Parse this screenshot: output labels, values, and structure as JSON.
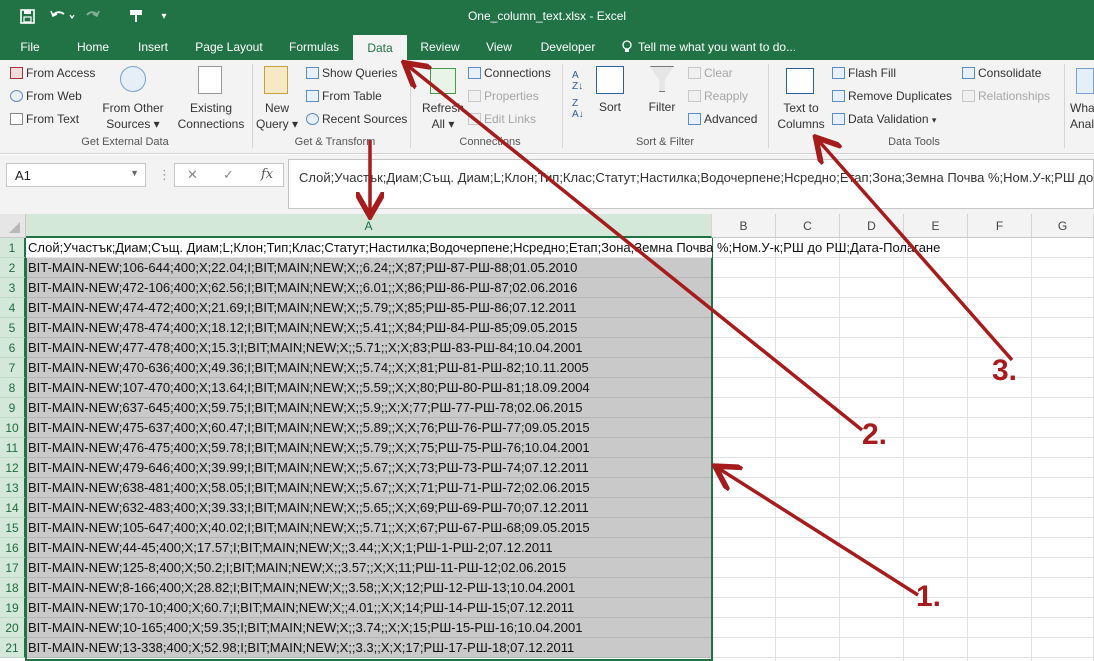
{
  "window": {
    "title": "One_column_text.xlsx - Excel"
  },
  "tabs": [
    {
      "label": "File",
      "active": false
    },
    {
      "label": "Home",
      "active": false
    },
    {
      "label": "Insert",
      "active": false
    },
    {
      "label": "Page Layout",
      "active": false
    },
    {
      "label": "Formulas",
      "active": false
    },
    {
      "label": "Data",
      "active": true
    },
    {
      "label": "Review",
      "active": false
    },
    {
      "label": "View",
      "active": false
    },
    {
      "label": "Developer",
      "active": false
    },
    {
      "label": "Tell me what you want to do...",
      "active": false
    }
  ],
  "ribbon": {
    "get_external": {
      "from_access": "From Access",
      "from_web": "From Web",
      "from_text": "From Text",
      "from_other_1": "From Other",
      "from_other_2": "Sources",
      "existing_1": "Existing",
      "existing_2": "Connections",
      "group": "Get External Data"
    },
    "transform": {
      "new_query_1": "New",
      "new_query_2": "Query",
      "show_queries": "Show Queries",
      "from_table": "From Table",
      "recent_sources": "Recent Sources",
      "group": "Get & Transform"
    },
    "connections": {
      "refresh_1": "Refresh",
      "refresh_2": "All",
      "connections": "Connections",
      "properties": "Properties",
      "edit_links": "Edit Links",
      "group": "Connections"
    },
    "sort_filter": {
      "sort": "Sort",
      "filter": "Filter",
      "clear": "Clear",
      "reapply": "Reapply",
      "advanced": "Advanced",
      "group": "Sort & Filter"
    },
    "data_tools": {
      "text_to_1": "Text to",
      "text_to_2": "Columns",
      "flash_fill": "Flash Fill",
      "remove_duplicates": "Remove Duplicates",
      "data_validation": "Data Validation",
      "consolidate": "Consolidate",
      "relationships": "Relationships",
      "group": "Data Tools"
    },
    "whatif_1": "What",
    "whatif_2": "Analy"
  },
  "formula_bar": {
    "name_box": "A1",
    "fx": "fx",
    "content": "Слой;Участък;Диам;Същ. Диам;L;Клон;Тип;Клас;Статут;Настилка;Водочерпене;Нсредно;Етап;Зона;Земна Почва %;Ном.У-к;РШ до РШ;Дата-Полагане"
  },
  "columns": [
    "A",
    "B",
    "C",
    "D",
    "E",
    "F",
    "G"
  ],
  "rows": [
    {
      "n": "1",
      "a": "Слой;Участък;Диам;Същ. Диам;L;Клон;Тип;Клас;Статут;Настилка;Водочерпене;Нсредно;Етап;Зона;Земна Почва %;Ном.У-к;РШ до РШ;Дата-Полагане"
    },
    {
      "n": "2",
      "a": "BIT-MAIN-NEW;106-644;400;X;22.04;I;BIT;MAIN;NEW;X;;6.24;;X;87;РШ-87-РШ-88;01.05.2010"
    },
    {
      "n": "3",
      "a": "BIT-MAIN-NEW;472-106;400;X;62.56;I;BIT;MAIN;NEW;X;;6.01;;X;86;РШ-86-РШ-87;02.06.2016"
    },
    {
      "n": "4",
      "a": "BIT-MAIN-NEW;474-472;400;X;21.69;I;BIT;MAIN;NEW;X;;5.79;;X;85;РШ-85-РШ-86;07.12.2011"
    },
    {
      "n": "5",
      "a": "BIT-MAIN-NEW;478-474;400;X;18.12;I;BIT;MAIN;NEW;X;;5.41;;X;84;РШ-84-РШ-85;09.05.2015"
    },
    {
      "n": "6",
      "a": "BIT-MAIN-NEW;477-478;400;X;15.3;I;BIT;MAIN;NEW;X;;5.71;;X;X;83;РШ-83-РШ-84;10.04.2001"
    },
    {
      "n": "7",
      "a": "BIT-MAIN-NEW;470-636;400;X;49.36;I;BIT;MAIN;NEW;X;;5.74;;X;X;81;РШ-81-РШ-82;10.11.2005"
    },
    {
      "n": "8",
      "a": "BIT-MAIN-NEW;107-470;400;X;13.64;I;BIT;MAIN;NEW;X;;5.59;;X;X;80;РШ-80-РШ-81;18.09.2004"
    },
    {
      "n": "9",
      "a": "BIT-MAIN-NEW;637-645;400;X;59.75;I;BIT;MAIN;NEW;X;;5.9;;X;X;77;РШ-77-РШ-78;02.06.2015"
    },
    {
      "n": "10",
      "a": "BIT-MAIN-NEW;475-637;400;X;60.47;I;BIT;MAIN;NEW;X;;5.89;;X;X;76;РШ-76-РШ-77;09.05.2015"
    },
    {
      "n": "11",
      "a": "BIT-MAIN-NEW;476-475;400;X;59.78;I;BIT;MAIN;NEW;X;;5.79;;X;X;75;РШ-75-РШ-76;10.04.2001"
    },
    {
      "n": "12",
      "a": "BIT-MAIN-NEW;479-646;400;X;39.99;I;BIT;MAIN;NEW;X;;5.67;;X;X;73;РШ-73-РШ-74;07.12.2011"
    },
    {
      "n": "13",
      "a": "BIT-MAIN-NEW;638-481;400;X;58.05;I;BIT;MAIN;NEW;X;;5.67;;X;X;71;РШ-71-РШ-72;02.06.2015"
    },
    {
      "n": "14",
      "a": "BIT-MAIN-NEW;632-483;400;X;39.33;I;BIT;MAIN;NEW;X;;5.65;;X;X;69;РШ-69-РШ-70;07.12.2011"
    },
    {
      "n": "15",
      "a": "BIT-MAIN-NEW;105-647;400;X;40.02;I;BIT;MAIN;NEW;X;;5.71;;X;X;67;РШ-67-РШ-68;09.05.2015"
    },
    {
      "n": "16",
      "a": "BIT-MAIN-NEW;44-45;400;X;17.57;I;BIT;MAIN;NEW;X;;3.44;;X;X;1;РШ-1-РШ-2;07.12.2011"
    },
    {
      "n": "17",
      "a": "BIT-MAIN-NEW;125-8;400;X;50.2;I;BIT;MAIN;NEW;X;;3.57;;X;X;11;РШ-11-РШ-12;02.06.2015"
    },
    {
      "n": "18",
      "a": "BIT-MAIN-NEW;8-166;400;X;28.82;I;BIT;MAIN;NEW;X;;3.58;;X;X;12;РШ-12-РШ-13;10.04.2001"
    },
    {
      "n": "19",
      "a": "BIT-MAIN-NEW;170-10;400;X;60.7;I;BIT;MAIN;NEW;X;;4.01;;X;X;14;РШ-14-РШ-15;07.12.2011"
    },
    {
      "n": "20",
      "a": "BIT-MAIN-NEW;10-165;400;X;59.35;I;BIT;MAIN;NEW;X;;3.74;;X;X;15;РШ-15-РШ-16;10.04.2001"
    },
    {
      "n": "21",
      "a": "BIT-MAIN-NEW;13-338;400;X;52.98;I;BIT;MAIN;NEW;X;;3.3;;X;X;17;РШ-17-РШ-18;07.12.2011"
    }
  ],
  "annotations": {
    "step1": "1.",
    "step2": "2.",
    "step3": "3."
  },
  "colors": {
    "excel_green": "#217346",
    "arrow_red": "#a61c1c",
    "selection_fill": "#c9c9c9"
  }
}
